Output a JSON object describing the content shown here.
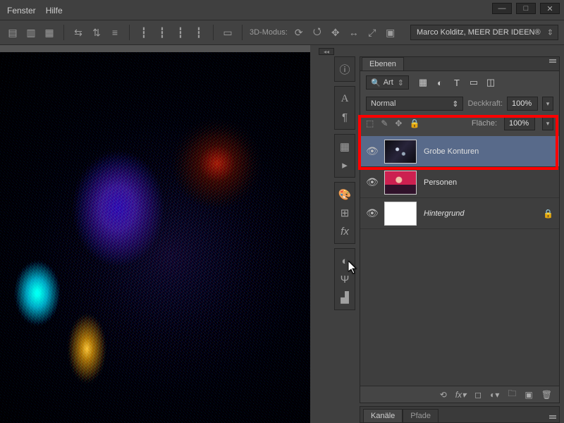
{
  "menubar": {
    "fenster": "Fenster",
    "hilfe": "Hilfe"
  },
  "options": {
    "mode3d_label": "3D-Modus:",
    "workspace": "Marco Kolditz, MEER DER IDEEN®"
  },
  "panel": {
    "tab": "Ebenen",
    "kind_label": "Art",
    "blend_mode": "Normal",
    "opacity_label": "Deckkraft:",
    "opacity_value": "100%",
    "fill_label": "Fläche:",
    "fill_value": "100%"
  },
  "layers": [
    {
      "name": "Grobe Konturen",
      "selected": true,
      "thumb": "grobe",
      "locked": false
    },
    {
      "name": "Personen",
      "selected": false,
      "thumb": "personen",
      "locked": false
    },
    {
      "name": "Hintergrund",
      "selected": false,
      "thumb": "bg",
      "locked": true,
      "italic": true
    }
  ],
  "channels": {
    "tab1": "Kanäle",
    "tab2": "Pfade"
  }
}
